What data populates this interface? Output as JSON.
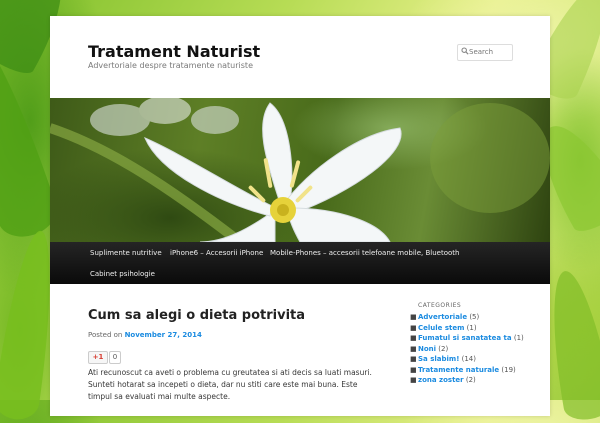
{
  "site": {
    "title": "Tratament Naturist",
    "description": "Advertoriale despre tratamente naturiste"
  },
  "search": {
    "placeholder": "Search"
  },
  "nav": {
    "items": [
      "Suplimente nutritive",
      "iPhone6 – Accesorii iPhone",
      "Mobile-Phones – accesorii telefoane mobile, Bluetooth",
      "Cabinet psihologie"
    ]
  },
  "post": {
    "title": "Cum sa alegi o dieta potrivita",
    "posted_label": "Posted on",
    "date": "November 27, 2014",
    "gplus_label": "+1",
    "gplus_count": "0",
    "body": "Ati recunoscut ca aveti o problema cu greutatea si ati decis sa luati masuri. Sunteti hotarat sa incepeti o dieta, dar nu stiti care este mai buna. Este timpul sa evaluati mai multe aspecte."
  },
  "sidebar": {
    "heading": "CATEGORIES",
    "categories": [
      {
        "name": "Advertoriale",
        "count": "(5)"
      },
      {
        "name": "Celule stem",
        "count": "(1)"
      },
      {
        "name": "Fumatul si sanatatea ta",
        "count": "(1)"
      },
      {
        "name": "Noni",
        "count": "(2)"
      },
      {
        "name": "Sa slabim!",
        "count": "(14)"
      },
      {
        "name": "Tratamente naturale",
        "count": "(19)"
      },
      {
        "name": "zona zoster",
        "count": "(2)"
      }
    ]
  },
  "colors": {
    "link": "#1b8be0",
    "nav_bg": "#111111",
    "background_green": "#b7dc55"
  },
  "icons": {
    "search": "magnifier-icon",
    "banner": "white-flower-photo",
    "background": "green-leaves-photo"
  }
}
